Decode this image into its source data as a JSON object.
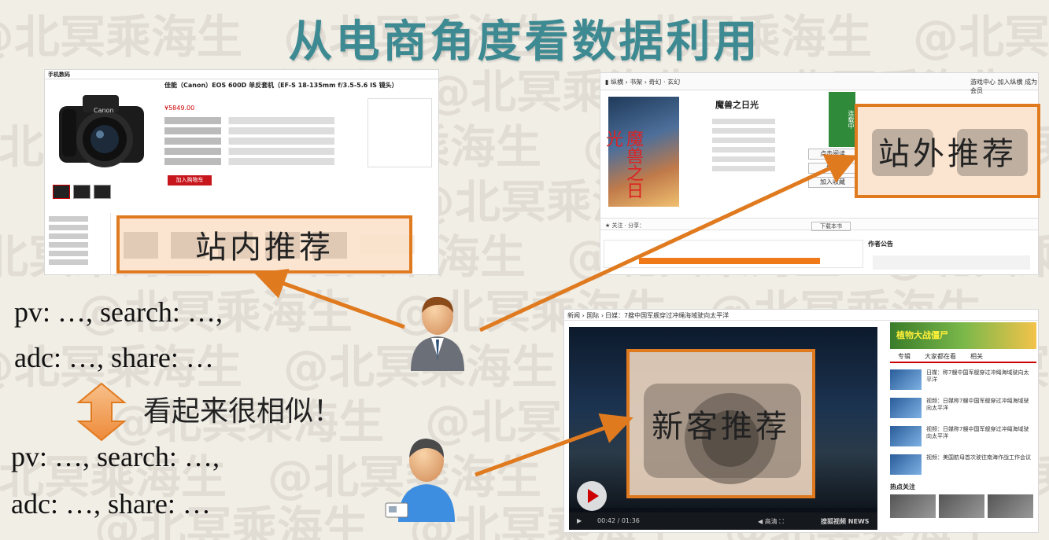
{
  "title": "从电商角度看数据利用",
  "watermark": "@北冥乘海生",
  "in_site_label": "站内推荐",
  "off_site_label": "站外推荐",
  "new_user_label": "新客推荐",
  "user1_lines": [
    "pv: …, search: …,",
    "adc: …, share: …"
  ],
  "user2_lines": [
    "pv: …, search: …,",
    "adc: …, share: …"
  ],
  "similar_text": "看起来很相似！",
  "product_page": {
    "category": "手机数码",
    "product_title": "佳能（Canon）EOS 600D 单反套机（EF-S 18-135mm f/3.5-5.6 IS 镜头）",
    "price": "¥5849.00",
    "buy_button": "加入购物车"
  },
  "book_page": {
    "book_title": "魔兽之日光",
    "cover_text": "魔兽之日光",
    "add_bookmark": "加入收藏",
    "download": "下载本书",
    "author_notice": "作者公告",
    "serial": "连载中"
  },
  "video_page": {
    "headline": "日媒：7艘中国军舰穿过冲绳海域驶向太平洋",
    "time": "00:42 / 01:36",
    "tab_channel": "专辑",
    "tab_watching": "大家都在看",
    "tab_related": "相关",
    "hot_title": "热点关注",
    "banner_text": "植物大战僵尸",
    "news_items": [
      "日媒：称7艘中国军舰穿过冲绳海域驶向太平洋",
      "视频：日媒称7艘中国军舰穿过冲绳海域驶向太平洋",
      "视频：日媒称7艘中国军舰穿过冲绳海域驶向太平洋",
      "视频：美国航母首次驶往南海作战工作会议"
    ]
  },
  "colors": {
    "title": "#3d8a92",
    "arrow": "#e07a1f",
    "box_border": "#e07a1f"
  }
}
